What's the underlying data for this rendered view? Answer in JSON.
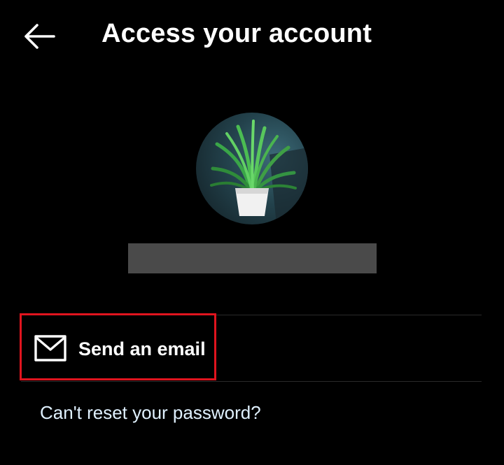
{
  "header": {
    "title": "Access your account",
    "back_icon": "arrow-left-icon"
  },
  "profile": {
    "avatar_icon": "potted-plant-avatar",
    "username_redacted": true
  },
  "options": {
    "send_email_label": "Send an email",
    "send_email_icon": "mail-icon"
  },
  "help": {
    "cant_reset_label": "Can't reset your password?"
  },
  "colors": {
    "background": "#000000",
    "text": "#ffffff",
    "link": "#e0f1ff",
    "highlight": "#e0141e",
    "divider": "#2a2a2a",
    "redaction": "#4a4a4a"
  }
}
